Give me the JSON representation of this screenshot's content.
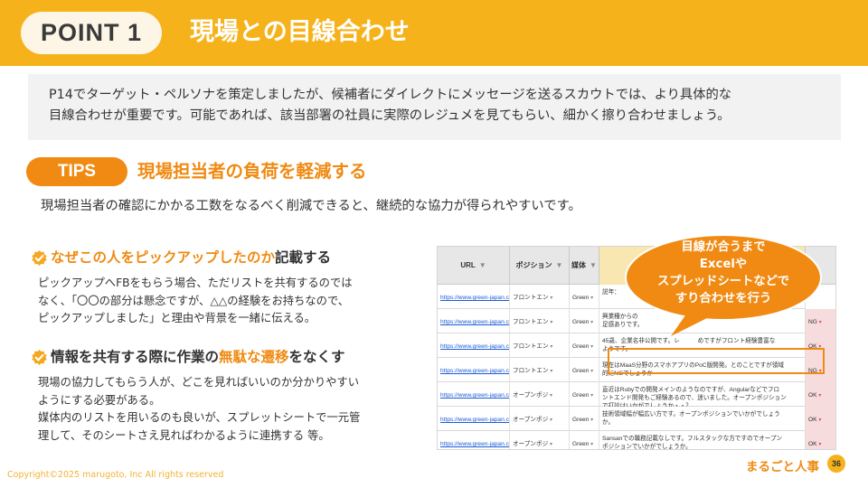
{
  "header": {
    "point_label": "POINT 1",
    "title": "現場との目線合わせ",
    "color": "#f6b21b"
  },
  "intro": {
    "line1": "P14でターゲット・ペルソナを策定しましたが、候補者にダイレクトにメッセージを送るスカウトでは、より具体的な",
    "line2": "目線合わせが重要です。可能であれば、該当部署の社員に実際のレジュメを見てもらい、細かく擦り合わせましょう。"
  },
  "tips": {
    "label": "TIPS",
    "title": "現場担当者の負荷を軽減する",
    "subtitle": "現場担当者の確認にかかる工数をなるべく削減できると、継続的な協力が得られやすいです。",
    "accent": "#f08a12"
  },
  "section1": {
    "heading_highlight": "なぜこの人をピックアップしたのか",
    "heading_rest": "記載する",
    "lines": [
      " ピックアップへFBをもらう場合、ただリストを共有するのでは",
      "なく、「〇〇の部分は懸念ですが、△△の経験をお持ちなので、",
      "ピックアップしました」と理由や背景を一緒に伝える。"
    ]
  },
  "section2": {
    "heading_a": "情報を共有する際に作業の",
    "heading_b": "無駄な遷移",
    "heading_c": "をなくす",
    "lines": [
      "現場の協力してもらう人が、どこを見ればいいのか分かりやすい",
      "ようにする必要がある。",
      "媒体内のリストを用いるのも良いが、スプレットシートで一元管",
      "理して、そのシートさえ見ればわかるように連携する 等。"
    ]
  },
  "bubble": {
    "lines": [
      "目線が合うまで",
      "Excelや",
      "スプレッドシートなどで",
      "すり合わせを行う"
    ]
  },
  "sheet": {
    "headers": [
      "URL",
      "ポジション",
      "媒体",
      "",
      ""
    ],
    "rows": [
      {
        "url": "https://www.green-japan.com",
        "pos": "フロントエン",
        "med": "Green",
        "cmt": "説年：",
        "st": ""
      },
      {
        "url": "https://www.green-japan.com",
        "pos": "フロントエン",
        "med": "Green",
        "cmt": "興業種からの\n足感ありです。",
        "st": "NG"
      },
      {
        "url": "https://www.green-japan.com",
        "pos": "フロントエン",
        "med": "Green",
        "cmt": "45歳、企業名非公開です。レ　　　めですがフロント経験豊富な\nようです。",
        "st": "OK"
      },
      {
        "url": "https://www.green-japan.com",
        "pos": "フロントエン",
        "med": "Green",
        "cmt": "現在はMaaS分野のスマホアプリのPoC版開発。とのことですが領域\n的にNGでしょうか",
        "st": "NG"
      },
      {
        "url": "https://www.green-japan.com",
        "pos": "オープンポジ",
        "med": "Green",
        "cmt": "直近はRubyでの開発メインのようなのですが、Angularなどでフロ\nントエンド開発もご経験あるので、迷いました。オープンポジション\nで打診はいかがでしょうか・・？",
        "st": "OK"
      },
      {
        "url": "https://www.green-japan.com",
        "pos": "オープンポジ",
        "med": "Green",
        "cmt": "技術領域幅が幅広い方です。オープンポジションでいかがでしょう\nか。",
        "st": "OK"
      },
      {
        "url": "https://www.green-japan.com",
        "pos": "オープンポジ",
        "med": "Green",
        "cmt": "Sansanでの職務記載なしです。フルスタックな方ですのでオープン\nポジションでいかがでしょうか。",
        "st": "OK"
      }
    ]
  },
  "footer": {
    "copyright": "Copyright©2025 marugoto, Inc All rights reserved",
    "brand": "まるごと人事",
    "page": "36"
  }
}
